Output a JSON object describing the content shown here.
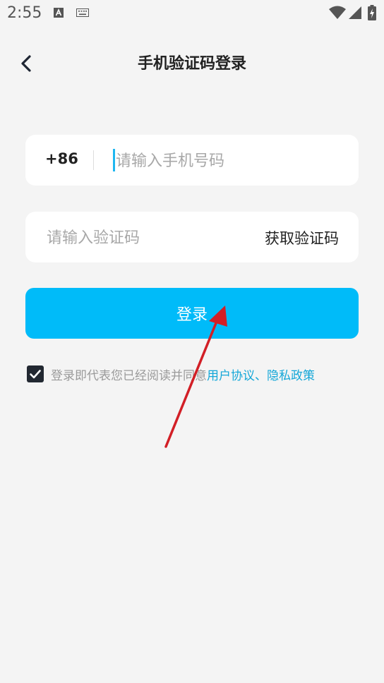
{
  "status_bar": {
    "time": "2:55",
    "icons": [
      "a-notification-icon",
      "keyboard-icon",
      "wifi-icon",
      "signal-icon",
      "battery-charging-icon"
    ]
  },
  "header": {
    "title": "手机验证码登录",
    "back_icon": "chevron-left-icon"
  },
  "phone": {
    "country_code": "+86",
    "placeholder": "请输入手机号码",
    "value": ""
  },
  "code": {
    "placeholder": "请输入验证码",
    "value": "",
    "get_code_label": "获取验证码"
  },
  "login_button": {
    "label": "登录"
  },
  "agreement": {
    "checked": true,
    "prefix": "登录即代表您已经阅读并同意",
    "user_agreement": "用户协议",
    "separator": "、",
    "privacy_policy": "隐私政策"
  },
  "colors": {
    "background": "#f4f4f4",
    "primary": "#00bbf9",
    "link": "#14a7d8",
    "annotation_arrow": "#d21f26"
  }
}
